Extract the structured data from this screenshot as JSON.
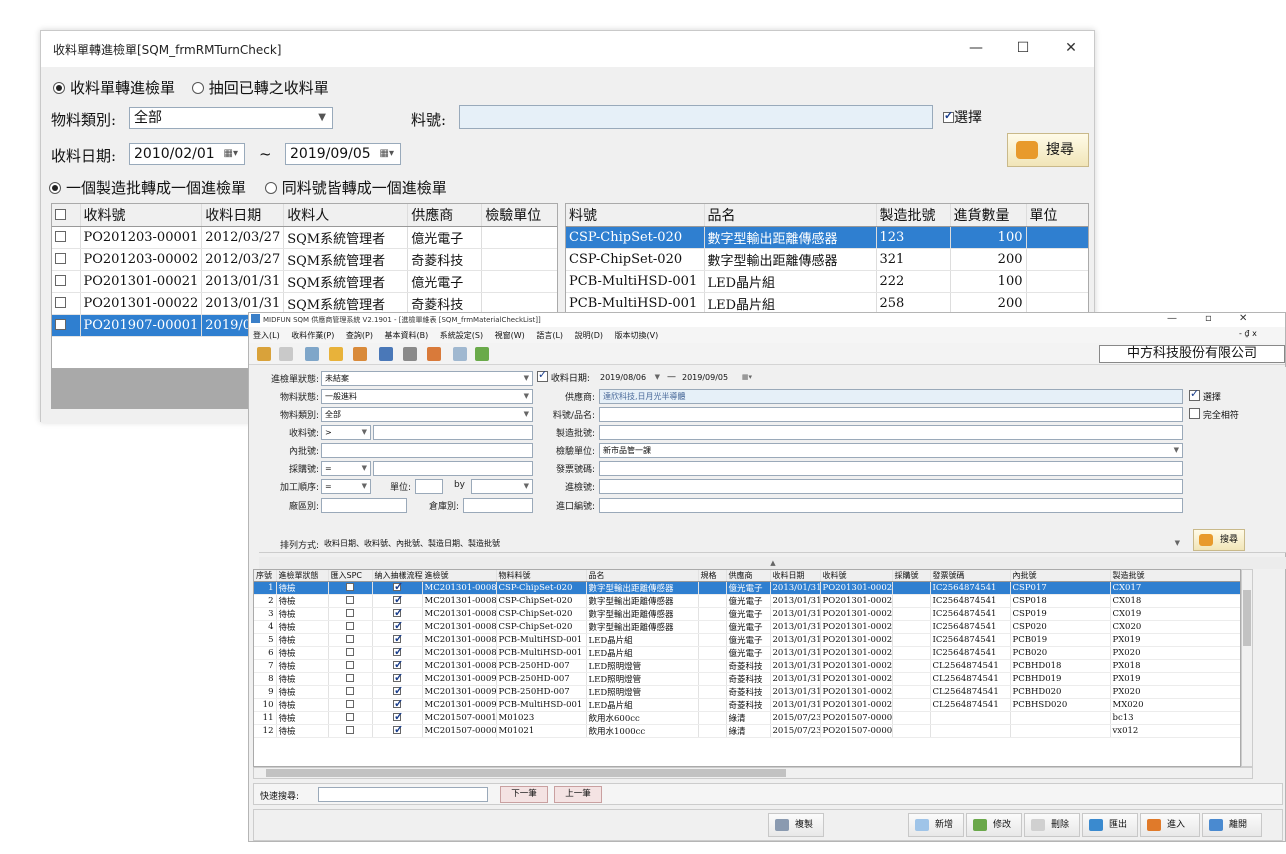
{
  "win1": {
    "title": "收料單轉進檢單[SQM_frmRMTurnCheck]",
    "controls": {
      "minimize": "—",
      "maximize": "☐",
      "close": "✕"
    },
    "mode_radio": [
      {
        "label": "收料單轉進檢單",
        "checked": true
      },
      {
        "label": "抽回已轉之收料單",
        "checked": false
      }
    ],
    "category_label": "物料類別:",
    "category_value": "全部",
    "part_label": "料號:",
    "part_value": "",
    "select_label": "選擇",
    "select_checked": true,
    "date_label": "收料日期:",
    "date_from": "2010/02/01",
    "date_sep": "~",
    "date_to": "2019/09/05",
    "search_label": "搜尋",
    "batch_radio": [
      {
        "label": "一個製造批轉成一個進檢單",
        "checked": true
      },
      {
        "label": "同料號皆轉成一個進檢單",
        "checked": false
      }
    ],
    "left_grid": {
      "columns": [
        "收料號",
        "收料日期",
        "收料人",
        "供應商",
        "檢驗單位"
      ],
      "rows": [
        [
          "PO201203-00001",
          "2012/03/27",
          "SQM系統管理者",
          "億光電子",
          ""
        ],
        [
          "PO201203-00002",
          "2012/03/27",
          "SQM系統管理者",
          "奇菱科技",
          ""
        ],
        [
          "PO201301-00021",
          "2013/01/31",
          "SQM系統管理者",
          "億光電子",
          ""
        ],
        [
          "PO201301-00022",
          "2013/01/31",
          "SQM系統管理者",
          "奇菱科技",
          ""
        ],
        [
          "PO201907-00001",
          "2019/0",
          "",
          "",
          ""
        ]
      ],
      "selected_row": 4
    },
    "right_grid": {
      "columns": [
        "料號",
        "品名",
        "製造批號",
        "進貨數量",
        "單位"
      ],
      "rows": [
        [
          "CSP-ChipSet-020",
          "數字型輸出距離傳感器",
          "123",
          "100",
          ""
        ],
        [
          "CSP-ChipSet-020",
          "數字型輸出距離傳感器",
          "321",
          "200",
          ""
        ],
        [
          "PCB-MultiHSD-001",
          "LED晶片組",
          "222",
          "100",
          ""
        ],
        [
          "PCB-MultiHSD-001",
          "LED晶片組",
          "258",
          "200",
          ""
        ]
      ],
      "selected_row": 0
    }
  },
  "win2": {
    "caption": "MIDFUN SQM 供應商管理系統 V2.1901 - [進檢單維表 [SQM_frmMaterialCheckList]]",
    "controls": {
      "minimize": "—",
      "restore": "▫",
      "close": "✕",
      "inner": "- ₫ x"
    },
    "menu": [
      "登入(L)",
      "收料作業(P)",
      "查詢(P)",
      "基本資料(B)",
      "系統設定(S)",
      "視窗(W)",
      "語言(L)",
      "說明(D)",
      "版本切換(V)"
    ],
    "company": "中方科技股份有限公司",
    "filters": {
      "status_label": "進檢單狀態:",
      "status_value": "未結案",
      "material_status_label": "物料狀態:",
      "material_status_value": "一般進料",
      "category_label": "物料類別:",
      "category_value": "全部",
      "receive_no_label": "收料號:",
      "receive_no_op": ">",
      "internal_batch_label": "內批號:",
      "purchase_no_label": "採購號:",
      "purchase_no_op": "=",
      "process_label": "加工順序:",
      "process_op": "=",
      "unit_label": "單位:",
      "by_label": "by",
      "factory_label": "廠區別:",
      "warehouse_label": "倉庫別:",
      "date_label": "收料日期:",
      "date_from": "2019/08/06",
      "date_sep": "—",
      "date_to": "2019/09/05",
      "supplier_label": "供應商:",
      "supplier_value": "達欣科技,日月光半導體",
      "part_label": "料號/品名:",
      "mfg_batch_label": "製造批號:",
      "inspect_unit_label": "檢驗單位:",
      "inspect_unit_value": "新市品管一課",
      "invoice_label": "發票號碼:",
      "check_no_label": "進檢號:",
      "import_no_label": "進口編號:",
      "select_label": "選擇",
      "exact_label": "完全相符",
      "sort_label": "排列方式:",
      "sort_value": "收料日期、收料號、內批號、製造日期、製造批號",
      "search_label": "搜尋"
    },
    "grid": {
      "columns": [
        "序號",
        "進檢單狀態",
        "匯入SPC",
        "納入抽樣流程",
        "進檢號",
        "物料料號",
        "品名",
        "規格",
        "供應商",
        "收料日期",
        "收料號",
        "採購號",
        "發票號碼",
        "內批號",
        "製造批號"
      ],
      "rows": [
        [
          "1",
          "待檢",
          false,
          true,
          "MC201301-00081",
          "CSP-ChipSet-020",
          "數字型輸出距離傳感器",
          "",
          "億光電子",
          "2013/01/31",
          "PO201301-00023",
          "",
          "IC2564874541",
          "CSP017",
          "CX017"
        ],
        [
          "2",
          "待檢",
          false,
          true,
          "MC201301-00082",
          "CSP-ChipSet-020",
          "數字型輸出距離傳感器",
          "",
          "億光電子",
          "2013/01/31",
          "PO201301-00023",
          "",
          "IC2564874541",
          "CSP018",
          "CX018"
        ],
        [
          "3",
          "待檢",
          false,
          true,
          "MC201301-00083",
          "CSP-ChipSet-020",
          "數字型輸出距離傳感器",
          "",
          "億光電子",
          "2013/01/31",
          "PO201301-00023",
          "",
          "IC2564874541",
          "CSP019",
          "CX019"
        ],
        [
          "4",
          "待檢",
          false,
          true,
          "MC201301-00084",
          "CSP-ChipSet-020",
          "數字型輸出距離傳感器",
          "",
          "億光電子",
          "2013/01/31",
          "PO201301-00023",
          "",
          "IC2564874541",
          "CSP020",
          "CX020"
        ],
        [
          "5",
          "待檢",
          false,
          true,
          "MC201301-00087",
          "PCB-MultiHSD-001",
          "LED晶片組",
          "",
          "億光電子",
          "2013/01/31",
          "PO201301-00023",
          "",
          "IC2564874541",
          "PCB019",
          "PX019"
        ],
        [
          "6",
          "待檢",
          false,
          true,
          "MC201301-00088",
          "PCB-MultiHSD-001",
          "LED晶片組",
          "",
          "億光電子",
          "2013/01/31",
          "PO201301-00023",
          "",
          "IC2564874541",
          "PCB020",
          "PX020"
        ],
        [
          "7",
          "待檢",
          false,
          true,
          "MC201301-00089",
          "PCB-250HD-007",
          "LED照明燈管",
          "",
          "奇菱科技",
          "2013/01/31",
          "PO201301-00024",
          "",
          "CL2564874541",
          "PCBHD018",
          "PX018"
        ],
        [
          "8",
          "待檢",
          false,
          true,
          "MC201301-00090",
          "PCB-250HD-007",
          "LED照明燈管",
          "",
          "奇菱科技",
          "2013/01/31",
          "PO201301-00024",
          "",
          "CL2564874541",
          "PCBHD019",
          "PX019"
        ],
        [
          "9",
          "待檢",
          false,
          true,
          "MC201301-00091",
          "PCB-250HD-007",
          "LED照明燈管",
          "",
          "奇菱科技",
          "2013/01/31",
          "PO201301-00024",
          "",
          "CL2564874541",
          "PCBHD020",
          "PX020"
        ],
        [
          "10",
          "待檢",
          false,
          true,
          "MC201301-00094",
          "PCB-MultiHSD-001",
          "LED晶片組",
          "",
          "奇菱科技",
          "2013/01/31",
          "PO201301-00024",
          "",
          "CL2564874541",
          "PCBHSD020",
          "MX020"
        ],
        [
          "11",
          "待檢",
          false,
          true,
          "MC201507-00010",
          "M01023",
          "飲用水600cc",
          "",
          "綠清",
          "2015/07/23",
          "PO201507-00002",
          "",
          "",
          "",
          "bc13"
        ],
        [
          "12",
          "待檢",
          false,
          true,
          "MC201507-00005",
          "M01021",
          "飲用水1000cc",
          "",
          "綠清",
          "2015/07/23",
          "PO201507-00002",
          "",
          "",
          "",
          "vx012"
        ]
      ],
      "selected_row": 0
    },
    "quick_search_label": "快速搜尋:",
    "next_label": "下一筆",
    "prev_label": "上一筆",
    "bottom_buttons": [
      "複製",
      "新增",
      "修改",
      "刪除",
      "匯出",
      "進入",
      "離開"
    ],
    "colors": {
      "selection": "#2f7fd0",
      "accent_icon": "#e89a2c"
    }
  }
}
